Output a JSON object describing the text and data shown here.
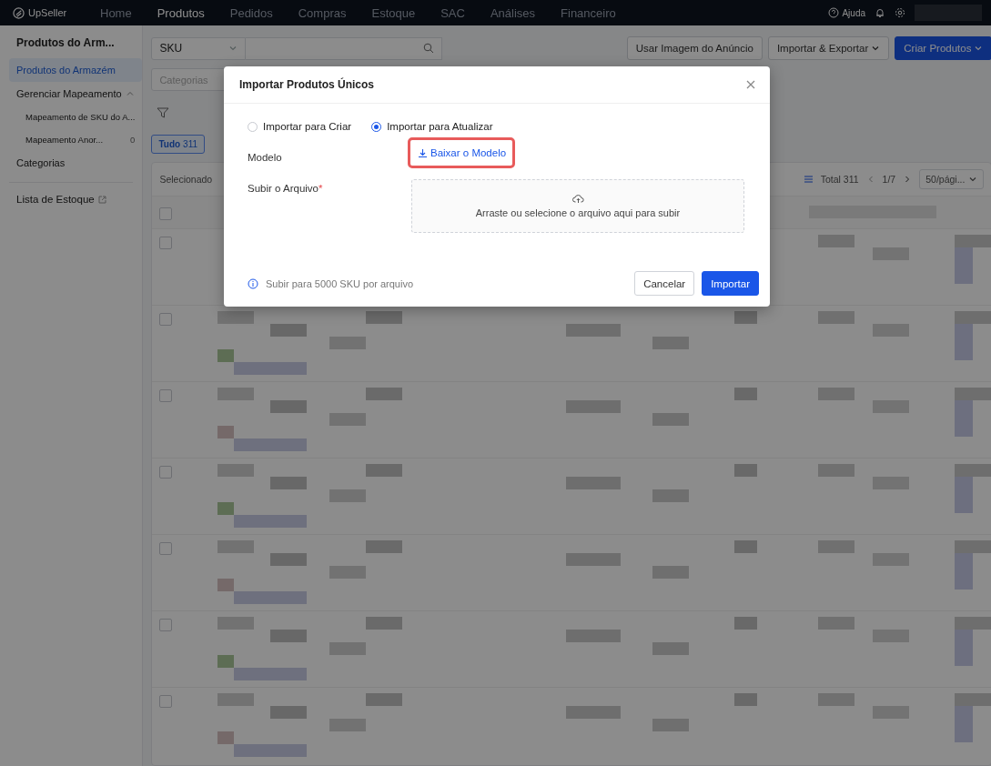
{
  "nav": {
    "logo": "UpSeller",
    "items": [
      {
        "label": "Home",
        "selected": false
      },
      {
        "label": "Produtos",
        "selected": true
      },
      {
        "label": "Pedidos",
        "selected": false
      },
      {
        "label": "Compras",
        "selected": false
      },
      {
        "label": "Estoque",
        "selected": false
      },
      {
        "label": "SAC",
        "selected": false
      },
      {
        "label": "Análises",
        "selected": false
      },
      {
        "label": "Financeiro",
        "selected": false
      }
    ],
    "help": "Ajuda"
  },
  "sidebar": {
    "title": "Produtos do Arm...",
    "items": [
      {
        "label": "Produtos do Armazém",
        "selected": true
      },
      {
        "label": "Gerenciar Mapeamento",
        "selected": false,
        "expanded": true,
        "children": [
          {
            "label": "Mapeamento de SKU do A...",
            "selected": false
          },
          {
            "label": "Mapeamento Anor...",
            "count": "0",
            "selected": false
          }
        ]
      },
      {
        "label": "Categorias",
        "selected": false
      }
    ],
    "external_link": "Lista de Estoque"
  },
  "filters": {
    "search_type": "SKU",
    "category_placeholder": "Categorias"
  },
  "actions": [
    "Usar Imagem do Anúncio",
    "Importar & Exportar",
    "Criar Produtos"
  ],
  "status_tab": {
    "label": "Tudo",
    "count": "311",
    "selected": true
  },
  "table_toolbar": {
    "selected_label": "Selecionado",
    "total": "Total 311",
    "page": "1/7",
    "page_size": "50/pági..."
  },
  "table": {
    "header_checked": false,
    "rows": [
      {
        "checked": false
      },
      {
        "checked": false
      },
      {
        "checked": false
      },
      {
        "checked": false
      },
      {
        "checked": false
      },
      {
        "checked": false
      },
      {
        "checked": false
      }
    ]
  },
  "dialog": {
    "title": "Importar Produtos Únicos",
    "modes": [
      {
        "label": "Importar para Criar",
        "selected": false
      },
      {
        "label": "Importar para Atualizar",
        "selected": true
      }
    ],
    "template_label": "Modelo",
    "template_link": "Baixar o Modelo",
    "file_label": "Subir o Arquivo",
    "required_mark": "*",
    "dropzone_text": "Arraste ou selecione o arquivo aqui para subir",
    "hint": "Subir para 5000 SKU por arquivo",
    "buttons": [
      {
        "label": "Cancelar",
        "kind": "secondary"
      },
      {
        "label": "Importar",
        "kind": "primary"
      }
    ]
  }
}
